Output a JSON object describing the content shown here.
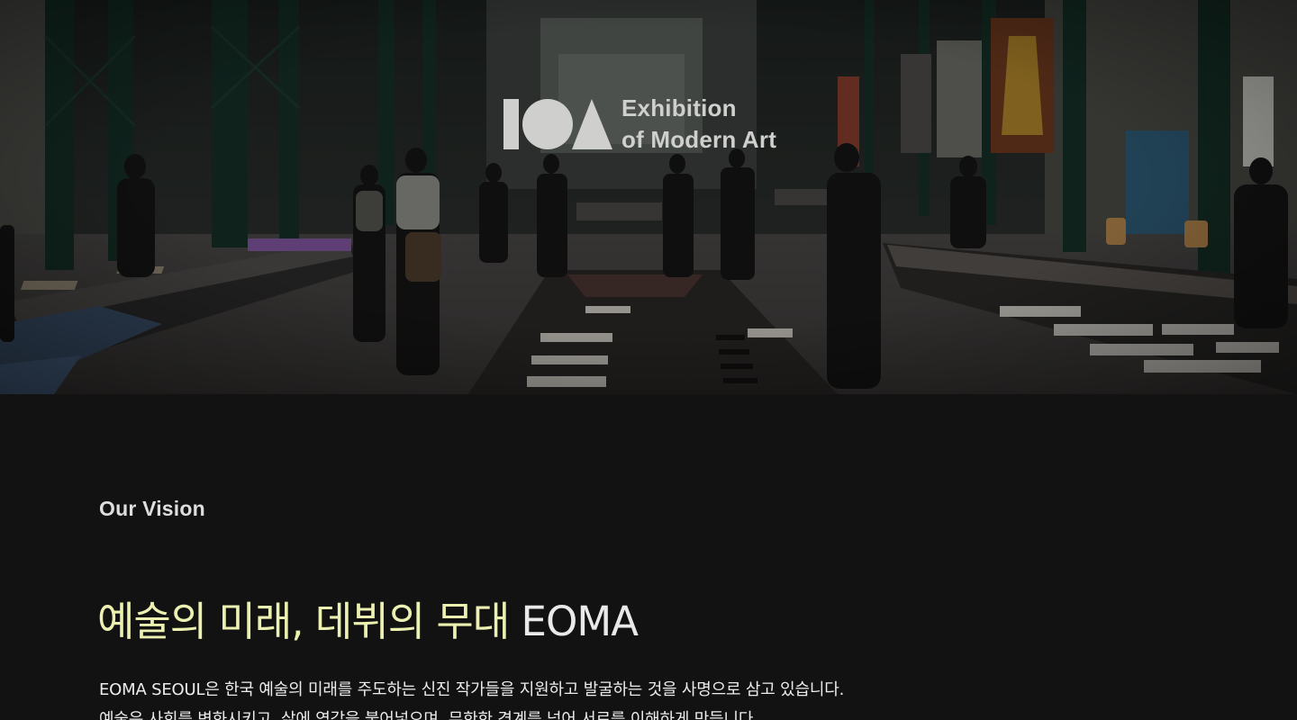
{
  "hero": {
    "image_alt": "exhibition-hall-photo",
    "logo": {
      "mark": "IOA",
      "line1": "Exhibition",
      "line2": "of Modern Art"
    }
  },
  "vision": {
    "label": "Our Vision",
    "headline_accent": "예술의 미래, 데뷔의 무대",
    "headline_plain": "EOMA",
    "body_lines": [
      "EOMA SEOUL은 한국 예술의 미래를 주도하는 신진 작가들을 지원하고 발굴하는 것을 사명으로 삼고 있습니다.",
      "예술은 사회를 변화시키고, 삶에 영감을 불어넣으며, 무한한 경계를 넘어 서로를 이해하게 만듭니다."
    ]
  },
  "colors": {
    "background": "#121212",
    "accent": "#ecf0b0",
    "text": "#e9e9e9"
  }
}
